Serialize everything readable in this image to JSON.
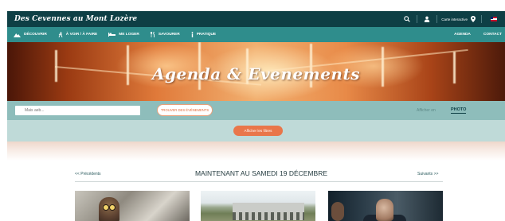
{
  "header": {
    "logo": "Des Cevennes au Mont Lozère",
    "map_link": "Carte interactive",
    "icons": [
      "search-icon",
      "user-icon",
      "location-pin-icon",
      "uk-flag-icon"
    ]
  },
  "nav": {
    "left": [
      {
        "label": "DÉCOUVRIR",
        "icon": "mountain-icon"
      },
      {
        "label": "À VOIR / À FAIRE",
        "icon": "hiker-icon"
      },
      {
        "label": "ME LOGER",
        "icon": "bed-icon"
      },
      {
        "label": "SAVOURER",
        "icon": "cutlery-icon"
      },
      {
        "label": "PRATIQUE",
        "icon": "info-icon"
      }
    ],
    "right": [
      {
        "label": "AGENDA"
      },
      {
        "label": "CONTACT"
      }
    ]
  },
  "hero": {
    "title": "Agenda & Evenements"
  },
  "filters": {
    "search_placeholder": "Mais aeb...",
    "find_button": "TROUVER DES ÉVÉNEMENTS",
    "show_as_label": "Afficher en",
    "photo_tab": "PHOTO",
    "show_filters_button": "Afficher les filtres"
  },
  "date_nav": {
    "previous": "<< Précédents",
    "heading": "MAINTENANT AU SAMEDI 19 DÉCEMBRE",
    "next": "Suivants >>"
  },
  "colors": {
    "top_bar": "#0e3f45",
    "nav_bar": "#2f8d8c",
    "filter_bar": "#8ebdbb",
    "accent_orange": "#e9764a"
  }
}
